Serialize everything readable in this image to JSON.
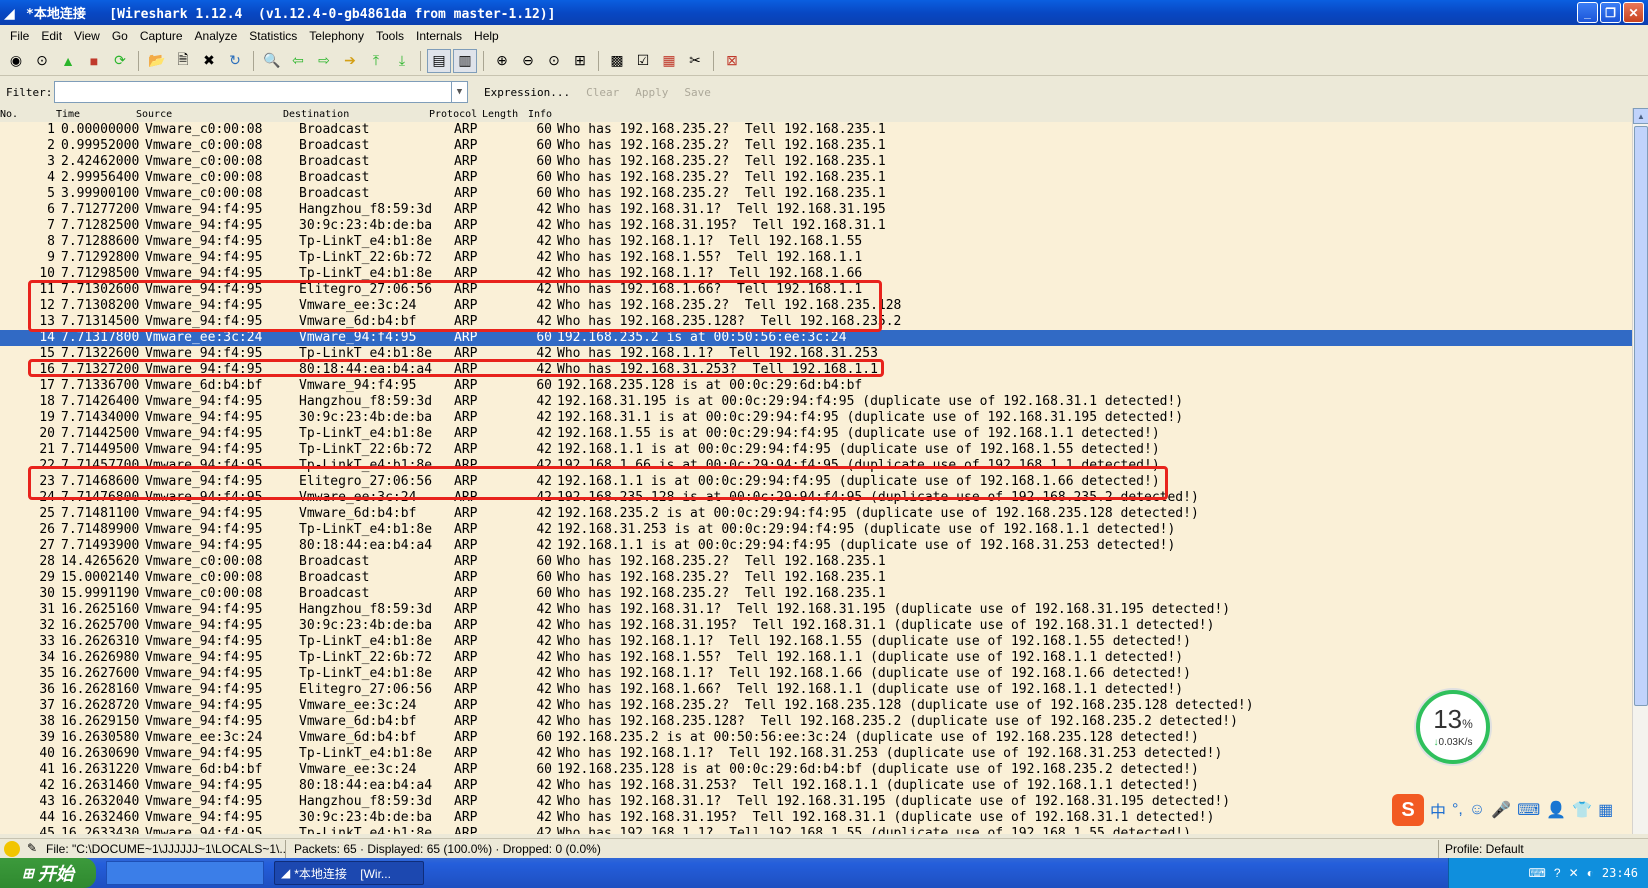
{
  "window": {
    "title": "*本地连接   [Wireshark 1.12.4  (v1.12.4-0-gb4861da from master-1.12)]",
    "title_icon": "shark-fin-icon",
    "buttons": [
      "minimize",
      "restore",
      "close"
    ]
  },
  "menu": [
    "File",
    "Edit",
    "View",
    "Go",
    "Capture",
    "Analyze",
    "Statistics",
    "Telephony",
    "Tools",
    "Internals",
    "Help"
  ],
  "toolbar": [
    {
      "name": "interfaces-icon",
      "glyph": "◉"
    },
    {
      "name": "options-icon",
      "glyph": "⊙"
    },
    {
      "name": "start-capture-icon",
      "glyph": "▲",
      "color": "#2bb52b"
    },
    {
      "name": "stop-capture-icon",
      "glyph": "■",
      "color": "#c0392b"
    },
    {
      "name": "restart-capture-icon",
      "glyph": "⟳",
      "color": "#2bb52b"
    },
    {
      "sep": true
    },
    {
      "name": "open-icon",
      "glyph": "📂"
    },
    {
      "name": "save-icon",
      "glyph": "🗎"
    },
    {
      "name": "close-file-icon",
      "glyph": "✖"
    },
    {
      "name": "reload-icon",
      "glyph": "↻",
      "color": "#2a6ebb"
    },
    {
      "sep": true
    },
    {
      "name": "find-icon",
      "glyph": "🔍"
    },
    {
      "name": "back-icon",
      "glyph": "⇦",
      "color": "#2bb52b"
    },
    {
      "name": "forward-icon",
      "glyph": "⇨",
      "color": "#2bb52b"
    },
    {
      "name": "goto-icon",
      "glyph": "➔",
      "color": "#d4a017"
    },
    {
      "name": "first-packet-icon",
      "glyph": "⤒",
      "color": "#2bb52b"
    },
    {
      "name": "last-packet-icon",
      "glyph": "⤓",
      "color": "#2bb52b"
    },
    {
      "sep": true
    },
    {
      "name": "colorize-icon",
      "glyph": "▤",
      "pressed": true
    },
    {
      "name": "autoscroll-icon",
      "glyph": "▥",
      "pressed": true
    },
    {
      "sep": true
    },
    {
      "name": "zoom-in-icon",
      "glyph": "⊕"
    },
    {
      "name": "zoom-out-icon",
      "glyph": "⊖"
    },
    {
      "name": "zoom-normal-icon",
      "glyph": "⊙"
    },
    {
      "name": "resize-columns-icon",
      "glyph": "⊞"
    },
    {
      "sep": true
    },
    {
      "name": "capture-filters-icon",
      "glyph": "▩"
    },
    {
      "name": "display-filters-icon",
      "glyph": "☑"
    },
    {
      "name": "coloring-rules-icon",
      "glyph": "▦",
      "color": "#c0392b"
    },
    {
      "name": "preferences-icon",
      "glyph": "✂"
    },
    {
      "sep": true
    },
    {
      "name": "help-icon",
      "glyph": "⊠",
      "color": "#c0392b"
    }
  ],
  "filter": {
    "label": "Filter:",
    "value": "",
    "expression": "Expression...",
    "clear": "Clear",
    "apply": "Apply",
    "save": "Save"
  },
  "columns": [
    "No.",
    "Time",
    "Source",
    "Destination",
    "Protocol",
    "Length",
    "Info"
  ],
  "packets": [
    [
      "1",
      "0.00000000",
      "Vmware_c0:00:08",
      "Broadcast",
      "ARP",
      "60",
      "Who has 192.168.235.2?  Tell 192.168.235.1"
    ],
    [
      "2",
      "0.99952000",
      "Vmware_c0:00:08",
      "Broadcast",
      "ARP",
      "60",
      "Who has 192.168.235.2?  Tell 192.168.235.1"
    ],
    [
      "3",
      "2.42462000",
      "Vmware_c0:00:08",
      "Broadcast",
      "ARP",
      "60",
      "Who has 192.168.235.2?  Tell 192.168.235.1"
    ],
    [
      "4",
      "2.99956400",
      "Vmware_c0:00:08",
      "Broadcast",
      "ARP",
      "60",
      "Who has 192.168.235.2?  Tell 192.168.235.1"
    ],
    [
      "5",
      "3.99900100",
      "Vmware_c0:00:08",
      "Broadcast",
      "ARP",
      "60",
      "Who has 192.168.235.2?  Tell 192.168.235.1"
    ],
    [
      "6",
      "7.71277200",
      "Vmware_94:f4:95",
      "Hangzhou_f8:59:3d",
      "ARP",
      "42",
      "Who has 192.168.31.1?  Tell 192.168.31.195"
    ],
    [
      "7",
      "7.71282500",
      "Vmware_94:f4:95",
      "30:9c:23:4b:de:ba",
      "ARP",
      "42",
      "Who has 192.168.31.195?  Tell 192.168.31.1"
    ],
    [
      "8",
      "7.71288600",
      "Vmware_94:f4:95",
      "Tp-LinkT_e4:b1:8e",
      "ARP",
      "42",
      "Who has 192.168.1.1?  Tell 192.168.1.55"
    ],
    [
      "9",
      "7.71292800",
      "Vmware_94:f4:95",
      "Tp-LinkT_22:6b:72",
      "ARP",
      "42",
      "Who has 192.168.1.55?  Tell 192.168.1.1"
    ],
    [
      "10",
      "7.71298500",
      "Vmware_94:f4:95",
      "Tp-LinkT_e4:b1:8e",
      "ARP",
      "42",
      "Who has 192.168.1.1?  Tell 192.168.1.66"
    ],
    [
      "11",
      "7.71302600",
      "Vmware_94:f4:95",
      "Elitegro_27:06:56",
      "ARP",
      "42",
      "Who has 192.168.1.66?  Tell 192.168.1.1"
    ],
    [
      "12",
      "7.71308200",
      "Vmware_94:f4:95",
      "Vmware_ee:3c:24",
      "ARP",
      "42",
      "Who has 192.168.235.2?  Tell 192.168.235.128"
    ],
    [
      "13",
      "7.71314500",
      "Vmware_94:f4:95",
      "Vmware_6d:b4:bf",
      "ARP",
      "42",
      "Who has 192.168.235.128?  Tell 192.168.235.2"
    ],
    [
      "14",
      "7.71317800",
      "Vmware_ee:3c:24",
      "Vmware_94:f4:95",
      "ARP",
      "60",
      "192.168.235.2 is at 00:50:56:ee:3c:24"
    ],
    [
      "15",
      "7.71322600",
      "Vmware_94:f4:95",
      "Tp-LinkT_e4:b1:8e",
      "ARP",
      "42",
      "Who has 192.168.1.1?  Tell 192.168.31.253"
    ],
    [
      "16",
      "7.71327200",
      "Vmware_94:f4:95",
      "80:18:44:ea:b4:a4",
      "ARP",
      "42",
      "Who has 192.168.31.253?  Tell 192.168.1.1"
    ],
    [
      "17",
      "7.71336700",
      "Vmware_6d:b4:bf",
      "Vmware_94:f4:95",
      "ARP",
      "60",
      "192.168.235.128 is at 00:0c:29:6d:b4:bf"
    ],
    [
      "18",
      "7.71426400",
      "Vmware_94:f4:95",
      "Hangzhou_f8:59:3d",
      "ARP",
      "42",
      "192.168.31.195 is at 00:0c:29:94:f4:95 (duplicate use of 192.168.31.1 detected!)"
    ],
    [
      "19",
      "7.71434000",
      "Vmware_94:f4:95",
      "30:9c:23:4b:de:ba",
      "ARP",
      "42",
      "192.168.31.1 is at 00:0c:29:94:f4:95 (duplicate use of 192.168.31.195 detected!)"
    ],
    [
      "20",
      "7.71442500",
      "Vmware_94:f4:95",
      "Tp-LinkT_e4:b1:8e",
      "ARP",
      "42",
      "192.168.1.55 is at 00:0c:29:94:f4:95 (duplicate use of 192.168.1.1 detected!)"
    ],
    [
      "21",
      "7.71449500",
      "Vmware_94:f4:95",
      "Tp-LinkT_22:6b:72",
      "ARP",
      "42",
      "192.168.1.1 is at 00:0c:29:94:f4:95 (duplicate use of 192.168.1.55 detected!)"
    ],
    [
      "22",
      "7.71457700",
      "Vmware_94:f4:95",
      "Tp-LinkT_e4:b1:8e",
      "ARP",
      "42",
      "192.168.1.66 is at 00:0c:29:94:f4:95 (duplicate use of 192.168.1.1 detected!)"
    ],
    [
      "23",
      "7.71468600",
      "Vmware_94:f4:95",
      "Elitegro_27:06:56",
      "ARP",
      "42",
      "192.168.1.1 is at 00:0c:29:94:f4:95 (duplicate use of 192.168.1.66 detected!)"
    ],
    [
      "24",
      "7.71476800",
      "Vmware_94:f4:95",
      "Vmware_ee:3c:24",
      "ARP",
      "42",
      "192.168.235.128 is at 00:0c:29:94:f4:95 (duplicate use of 192.168.235.2 detected!)"
    ],
    [
      "25",
      "7.71481100",
      "Vmware_94:f4:95",
      "Vmware_6d:b4:bf",
      "ARP",
      "42",
      "192.168.235.2 is at 00:0c:29:94:f4:95 (duplicate use of 192.168.235.128 detected!)"
    ],
    [
      "26",
      "7.71489900",
      "Vmware_94:f4:95",
      "Tp-LinkT_e4:b1:8e",
      "ARP",
      "42",
      "192.168.31.253 is at 00:0c:29:94:f4:95 (duplicate use of 192.168.1.1 detected!)"
    ],
    [
      "27",
      "7.71493900",
      "Vmware_94:f4:95",
      "80:18:44:ea:b4:a4",
      "ARP",
      "42",
      "192.168.1.1 is at 00:0c:29:94:f4:95 (duplicate use of 192.168.31.253 detected!)"
    ],
    [
      "28",
      "14.4265620",
      "Vmware_c0:00:08",
      "Broadcast",
      "ARP",
      "60",
      "Who has 192.168.235.2?  Tell 192.168.235.1"
    ],
    [
      "29",
      "15.0002140",
      "Vmware_c0:00:08",
      "Broadcast",
      "ARP",
      "60",
      "Who has 192.168.235.2?  Tell 192.168.235.1"
    ],
    [
      "30",
      "15.9991190",
      "Vmware_c0:00:08",
      "Broadcast",
      "ARP",
      "60",
      "Who has 192.168.235.2?  Tell 192.168.235.1"
    ],
    [
      "31",
      "16.2625160",
      "Vmware_94:f4:95",
      "Hangzhou_f8:59:3d",
      "ARP",
      "42",
      "Who has 192.168.31.1?  Tell 192.168.31.195 (duplicate use of 192.168.31.195 detected!)"
    ],
    [
      "32",
      "16.2625700",
      "Vmware_94:f4:95",
      "30:9c:23:4b:de:ba",
      "ARP",
      "42",
      "Who has 192.168.31.195?  Tell 192.168.31.1 (duplicate use of 192.168.31.1 detected!)"
    ],
    [
      "33",
      "16.2626310",
      "Vmware_94:f4:95",
      "Tp-LinkT_e4:b1:8e",
      "ARP",
      "42",
      "Who has 192.168.1.1?  Tell 192.168.1.55 (duplicate use of 192.168.1.55 detected!)"
    ],
    [
      "34",
      "16.2626980",
      "Vmware_94:f4:95",
      "Tp-LinkT_22:6b:72",
      "ARP",
      "42",
      "Who has 192.168.1.55?  Tell 192.168.1.1 (duplicate use of 192.168.1.1 detected!)"
    ],
    [
      "35",
      "16.2627600",
      "Vmware_94:f4:95",
      "Tp-LinkT_e4:b1:8e",
      "ARP",
      "42",
      "Who has 192.168.1.1?  Tell 192.168.1.66 (duplicate use of 192.168.1.66 detected!)"
    ],
    [
      "36",
      "16.2628160",
      "Vmware_94:f4:95",
      "Elitegro_27:06:56",
      "ARP",
      "42",
      "Who has 192.168.1.66?  Tell 192.168.1.1 (duplicate use of 192.168.1.1 detected!)"
    ],
    [
      "37",
      "16.2628720",
      "Vmware_94:f4:95",
      "Vmware_ee:3c:24",
      "ARP",
      "42",
      "Who has 192.168.235.2?  Tell 192.168.235.128 (duplicate use of 192.168.235.128 detected!)"
    ],
    [
      "38",
      "16.2629150",
      "Vmware_94:f4:95",
      "Vmware_6d:b4:bf",
      "ARP",
      "42",
      "Who has 192.168.235.128?  Tell 192.168.235.2 (duplicate use of 192.168.235.2 detected!)"
    ],
    [
      "39",
      "16.2630580",
      "Vmware_ee:3c:24",
      "Vmware_6d:b4:bf",
      "ARP",
      "60",
      "192.168.235.2 is at 00:50:56:ee:3c:24 (duplicate use of 192.168.235.128 detected!)"
    ],
    [
      "40",
      "16.2630690",
      "Vmware_94:f4:95",
      "Tp-LinkT_e4:b1:8e",
      "ARP",
      "42",
      "Who has 192.168.1.1?  Tell 192.168.31.253 (duplicate use of 192.168.31.253 detected!)"
    ],
    [
      "41",
      "16.2631220",
      "Vmware_6d:b4:bf",
      "Vmware_ee:3c:24",
      "ARP",
      "60",
      "192.168.235.128 is at 00:0c:29:6d:b4:bf (duplicate use of 192.168.235.2 detected!)"
    ],
    [
      "42",
      "16.2631460",
      "Vmware_94:f4:95",
      "80:18:44:ea:b4:a4",
      "ARP",
      "42",
      "Who has 192.168.31.253?  Tell 192.168.1.1 (duplicate use of 192.168.1.1 detected!)"
    ],
    [
      "43",
      "16.2632040",
      "Vmware_94:f4:95",
      "Hangzhou_f8:59:3d",
      "ARP",
      "42",
      "Who has 192.168.31.1?  Tell 192.168.31.195 (duplicate use of 192.168.31.195 detected!)"
    ],
    [
      "44",
      "16.2632460",
      "Vmware_94:f4:95",
      "30:9c:23:4b:de:ba",
      "ARP",
      "42",
      "Who has 192.168.31.195?  Tell 192.168.31.1 (duplicate use of 192.168.31.1 detected!)"
    ],
    [
      "45",
      "16.2633430",
      "Vmware_94:f4:95",
      "Tp-LinkT_e4:b1:8e",
      "ARP",
      "42",
      "Who has 192.168.1.1?  Tell 192.168.1.55 (duplicate use of 192.168.1.55 detected!)"
    ]
  ],
  "selected_packet": "14",
  "colors": {
    "row_bg": "#faf0d7",
    "selected_bg": "#316ac5",
    "highlight_box": "#e8231c"
  },
  "speed_widget": {
    "percent": "13",
    "percent_suffix": "%",
    "rate": "0.03K/s",
    "arrow_icon": "down-arrow-icon"
  },
  "ime": {
    "logo": "S",
    "items": [
      "中",
      "°,",
      "☺",
      "🎤",
      "⌨",
      "👤",
      "👕",
      "▦"
    ]
  },
  "status": {
    "file": "File: \"C:\\DOCUME~1\\JJJJJJ~1\\LOCALS~1\\...",
    "packets": "Packets: 65 · Displayed: 65 (100.0%) · Dropped: 0 (0.0%)",
    "profile": "Profile: Default"
  },
  "taskbar": {
    "start": "开始",
    "task_title": "*本地连接    [Wir...",
    "clock": "23:46"
  }
}
